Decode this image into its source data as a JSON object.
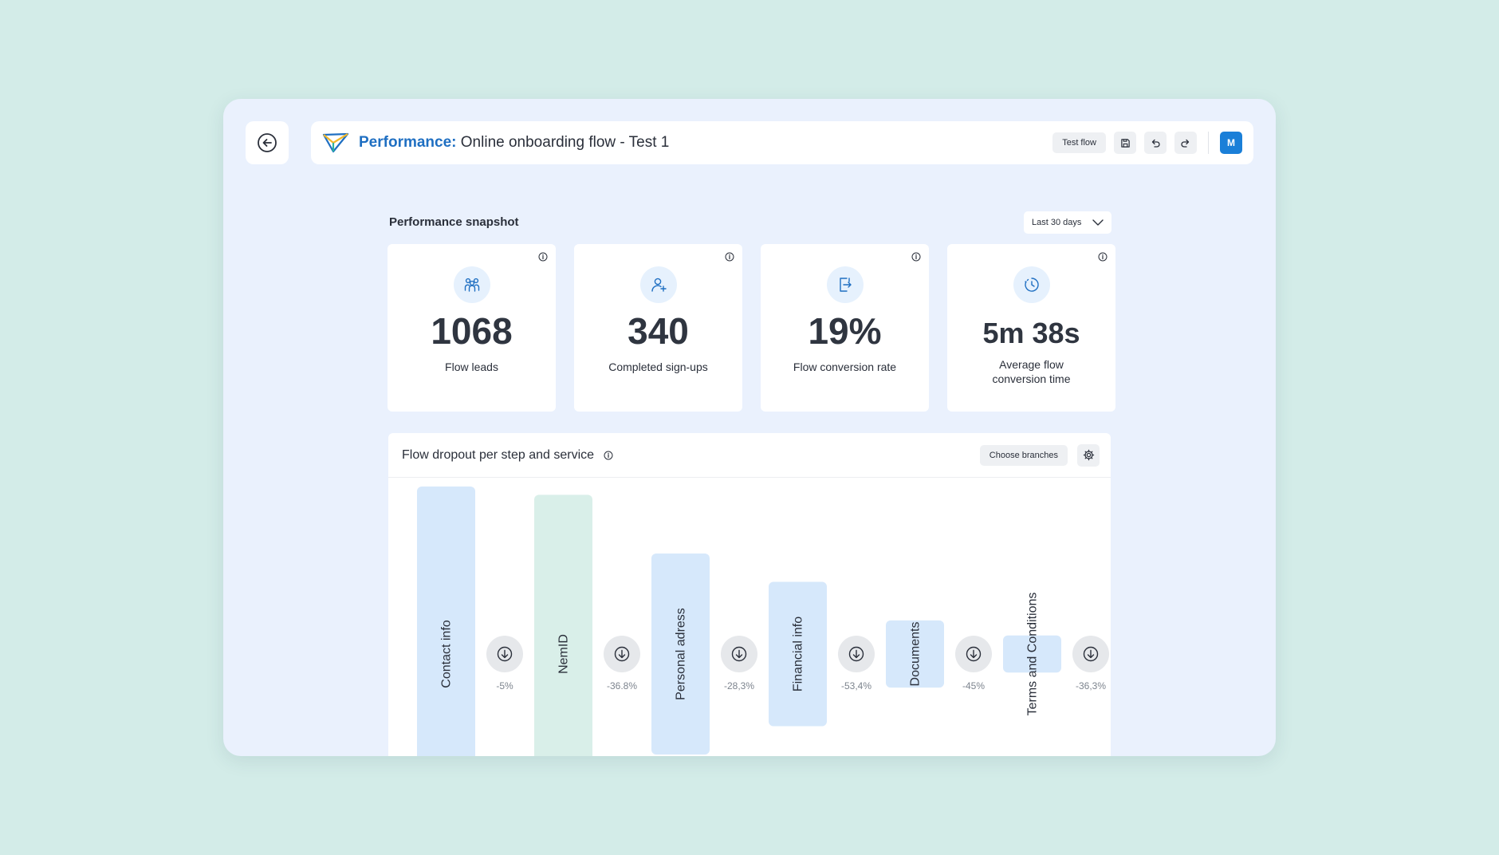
{
  "header": {
    "title_accent": "Performance:",
    "title_rest": "Online onboarding flow - Test 1",
    "test_flow_label": "Test flow",
    "avatar_initial": "M"
  },
  "snapshot": {
    "title": "Performance snapshot",
    "range": "Last 30 days"
  },
  "metrics": [
    {
      "value": "1068",
      "label": "Flow leads",
      "icon": "people-group-icon"
    },
    {
      "value": "340",
      "label": "Completed sign-ups",
      "icon": "user-add-icon"
    },
    {
      "value": "19%",
      "label": "Flow conversion rate",
      "icon": "conversion-icon"
    },
    {
      "value": "5m 38s",
      "label": "Average flow conversion time",
      "icon": "timer-icon"
    }
  ],
  "dropout": {
    "title": "Flow dropout per step and service",
    "choose_branches_label": "Choose branches"
  },
  "chart_data": {
    "type": "bar",
    "categories": [
      "Contact info",
      "NemID",
      "Personal adress",
      "Financial info",
      "Documents",
      "Terms and Conditions"
    ],
    "dropoff_labels": [
      "-5%",
      "-36.8%",
      "-28,3%",
      "-53,4%",
      "-45%",
      "-36,3%"
    ],
    "values": [
      1068,
      1015,
      641,
      460,
      214,
      118
    ],
    "colors": [
      "#d6e8fb",
      "#d9efe9",
      "#d6e8fb",
      "#d6e8fb",
      "#d6e8fb",
      "#d6e8fb"
    ]
  },
  "colors": {
    "accent": "#1f6fc2",
    "avatar": "#1a7fd8",
    "background": "#d3ece8",
    "window": "#eaf1fd"
  }
}
